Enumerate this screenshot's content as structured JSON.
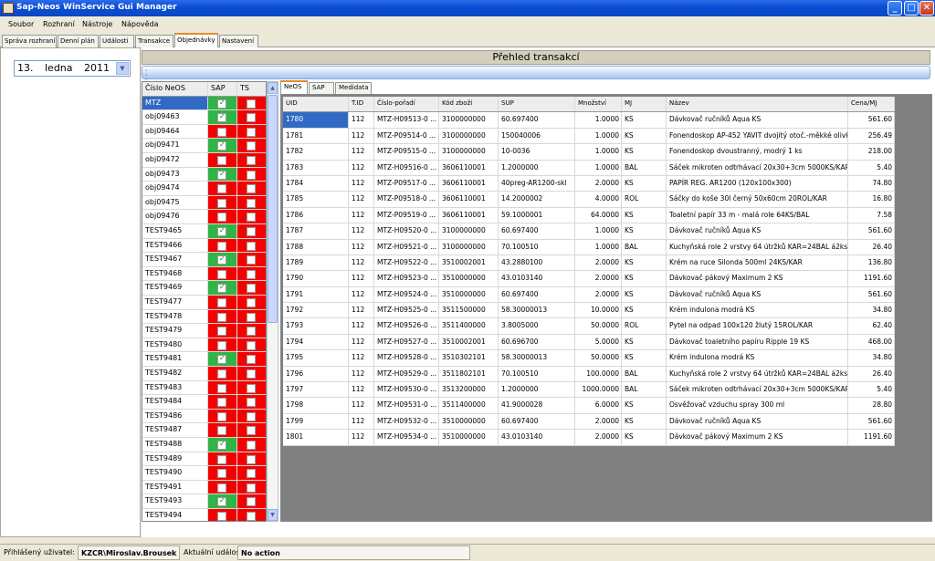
{
  "window": {
    "title": "Sap-Neos WinService Gui Manager",
    "min": "_",
    "max": "□",
    "close": "✕"
  },
  "menu": [
    "Soubor",
    "Rozhraní",
    "Nástroje",
    "Nápověda"
  ],
  "tabs": [
    "Správa rozhraní",
    "Denní plán",
    "Události",
    "Transakce",
    "Objednávky",
    "Nastavení"
  ],
  "active_tab_index": 4,
  "date": {
    "day": "13.",
    "month": "ledna",
    "year": "2011"
  },
  "header_title": "Přehled transakcí",
  "left_grid": {
    "columns": [
      "Číslo NeOS",
      "SAP",
      "TS"
    ],
    "rows": [
      {
        "id": "MTZ",
        "sap": true,
        "ts": false,
        "selected": true
      },
      {
        "id": "obj09463",
        "sap": true,
        "ts": false
      },
      {
        "id": "obj09464",
        "sap": false,
        "ts": false
      },
      {
        "id": "obj09471",
        "sap": true,
        "ts": false
      },
      {
        "id": "obj09472",
        "sap": false,
        "ts": false
      },
      {
        "id": "obj09473",
        "sap": true,
        "ts": false
      },
      {
        "id": "obj09474",
        "sap": false,
        "ts": false
      },
      {
        "id": "obj09475",
        "sap": false,
        "ts": false
      },
      {
        "id": "obj09476",
        "sap": false,
        "ts": false
      },
      {
        "id": "TEST9465",
        "sap": true,
        "ts": false
      },
      {
        "id": "TEST9466",
        "sap": false,
        "ts": false
      },
      {
        "id": "TEST9467",
        "sap": true,
        "ts": false
      },
      {
        "id": "TEST9468",
        "sap": false,
        "ts": false
      },
      {
        "id": "TEST9469",
        "sap": true,
        "ts": false
      },
      {
        "id": "TEST9477",
        "sap": false,
        "ts": false
      },
      {
        "id": "TEST9478",
        "sap": false,
        "ts": false
      },
      {
        "id": "TEST9479",
        "sap": false,
        "ts": false
      },
      {
        "id": "TEST9480",
        "sap": false,
        "ts": false
      },
      {
        "id": "TEST9481",
        "sap": true,
        "ts": false
      },
      {
        "id": "TEST9482",
        "sap": false,
        "ts": false
      },
      {
        "id": "TEST9483",
        "sap": false,
        "ts": false
      },
      {
        "id": "TEST9484",
        "sap": false,
        "ts": false
      },
      {
        "id": "TEST9486",
        "sap": false,
        "ts": false
      },
      {
        "id": "TEST9487",
        "sap": false,
        "ts": false
      },
      {
        "id": "TEST9488",
        "sap": true,
        "ts": false
      },
      {
        "id": "TEST9489",
        "sap": false,
        "ts": false
      },
      {
        "id": "TEST9490",
        "sap": false,
        "ts": false
      },
      {
        "id": "TEST9491",
        "sap": false,
        "ts": false
      },
      {
        "id": "TEST9493",
        "sap": true,
        "ts": false
      },
      {
        "id": "TEST9494",
        "sap": false,
        "ts": false
      }
    ]
  },
  "sub_tabs": [
    "NeOS",
    "SAP",
    "Medidata"
  ],
  "active_sub_tab_index": 0,
  "main_grid": {
    "columns": [
      "UID",
      "T.ID",
      "Číslo-pořadí",
      "Kód zboží",
      "SUP",
      "Množství",
      "MJ",
      "Název",
      "Cena/MJ"
    ],
    "rows": [
      [
        "1780",
        "112",
        "MTZ-H09513-0 ...",
        "3100000000",
        "60.697400",
        "1.0000",
        "KS",
        "Dávkovač ručníků Aqua KS",
        "561.60"
      ],
      [
        "1781",
        "112",
        "MTZ-P09514-0 ...",
        "3100000000",
        "150040006",
        "1.0000",
        "KS",
        "Fonendoskop AP-452 YAVIT dvojitý otoč.-měkké olivky...",
        "256.49"
      ],
      [
        "1782",
        "112",
        "MTZ-P09515-0 ...",
        "3100000000",
        "10-0036",
        "1.0000",
        "KS",
        "Fonendoskop dvoustranný, modrý 1 ks",
        "218.00"
      ],
      [
        "1783",
        "112",
        "MTZ-H09516-0 ...",
        "3606110001",
        "1.2000000",
        "1.0000",
        "BAL",
        "Sáček mikroten odtrhávací 20x30+3cm 5000KS/KAR",
        "5.40"
      ],
      [
        "1784",
        "112",
        "MTZ-P09517-0 ...",
        "3606110001",
        "40preg-AR1200-skl",
        "2.0000",
        "KS",
        "PAPÍR REG. AR1200 (120x100x300)",
        "74.80"
      ],
      [
        "1785",
        "112",
        "MTZ-P09518-0 ...",
        "3606110001",
        "14.2000002",
        "4.0000",
        "ROL",
        "Sáčky do koše 30l černý 50x60cm 20ROL/KAR",
        "16.80"
      ],
      [
        "1786",
        "112",
        "MTZ-P09519-0 ...",
        "3606110001",
        "59.1000001",
        "64.0000",
        "KS",
        "Toaletní papír 33 m - malá role 64KS/BAL",
        "7.58"
      ],
      [
        "1787",
        "112",
        "MTZ-H09520-0 ...",
        "3100000000",
        "60.697400",
        "1.0000",
        "KS",
        "Dávkovač ručníků Aqua KS",
        "561.60"
      ],
      [
        "1788",
        "112",
        "MTZ-H09521-0 ...",
        "3100000000",
        "70.100510",
        "1.0000",
        "BAL",
        "Kuchyňská role 2 vrstvy 64 útržků KAR=24BAL á2ks",
        "26.40"
      ],
      [
        "1789",
        "112",
        "MTZ-H09522-0 ...",
        "3510002001",
        "43.2880100",
        "2.0000",
        "KS",
        "Krém na ruce Silonda 500ml 24KS/KAR",
        "136.80"
      ],
      [
        "1790",
        "112",
        "MTZ-H09523-0 ...",
        "3510000000",
        "43.0103140",
        "2.0000",
        "KS",
        "Dávkovač pákový Maximum 2 KS",
        "1191.60"
      ],
      [
        "1791",
        "112",
        "MTZ-H09524-0 ...",
        "3510000000",
        "60.697400",
        "2.0000",
        "KS",
        "Dávkovač ručníků Aqua KS",
        "561.60"
      ],
      [
        "1792",
        "112",
        "MTZ-H09525-0 ...",
        "3511500000",
        "58.30000013",
        "10.0000",
        "KS",
        "Krém indulona modrá KS",
        "34.80"
      ],
      [
        "1793",
        "112",
        "MTZ-H09526-0 ...",
        "3511400000",
        "3.8005000",
        "50.0000",
        "ROL",
        "Pytel na odpad 100x120 žlutý 15ROL/KAR",
        "62.40"
      ],
      [
        "1794",
        "112",
        "MTZ-H09527-0 ...",
        "3510002001",
        "60.696700",
        "5.0000",
        "KS",
        "Dávkovač toaletního papíru Ripple 19 KS",
        "468.00"
      ],
      [
        "1795",
        "112",
        "MTZ-H09528-0 ...",
        "3510302101",
        "58.30000013",
        "50.0000",
        "KS",
        "Krém indulona modrá KS",
        "34.80"
      ],
      [
        "1796",
        "112",
        "MTZ-H09529-0 ...",
        "3511802101",
        "70.100510",
        "100.0000",
        "BAL",
        "Kuchyňská role 2 vrstvy 64 útržků KAR=24BAL á2ks",
        "26.40"
      ],
      [
        "1797",
        "112",
        "MTZ-H09530-0 ...",
        "3513200000",
        "1.2000000",
        "1000.0000",
        "BAL",
        "Sáček mikroten odtrhávací 20x30+3cm 5000KS/KAR",
        "5.40"
      ],
      [
        "1798",
        "112",
        "MTZ-H09531-0 ...",
        "3511400000",
        "41.9000028",
        "6.0000",
        "KS",
        "Osvěžovač vzduchu spray 300 ml",
        "28.80"
      ],
      [
        "1799",
        "112",
        "MTZ-H09532-0 ...",
        "3510000000",
        "60.697400",
        "2.0000",
        "KS",
        "Dávkovač ručníků Aqua KS",
        "561.60"
      ],
      [
        "1801",
        "112",
        "MTZ-H09534-0 ...",
        "3510000000",
        "43.0103140",
        "2.0000",
        "KS",
        "Dávkovač pákový Maximum 2 KS",
        "1191.60"
      ]
    ]
  },
  "status": {
    "user_label": "Přihlášený uživatel:",
    "user": "KZCR\\Miroslav.Brousek",
    "event_label": "Aktuální událost:",
    "event": "No action"
  },
  "colors": {
    "sap_on": "#2fb545",
    "flag_off": "#f40000",
    "selection": "#316ac5",
    "title_bar": "#0a4fd6"
  }
}
